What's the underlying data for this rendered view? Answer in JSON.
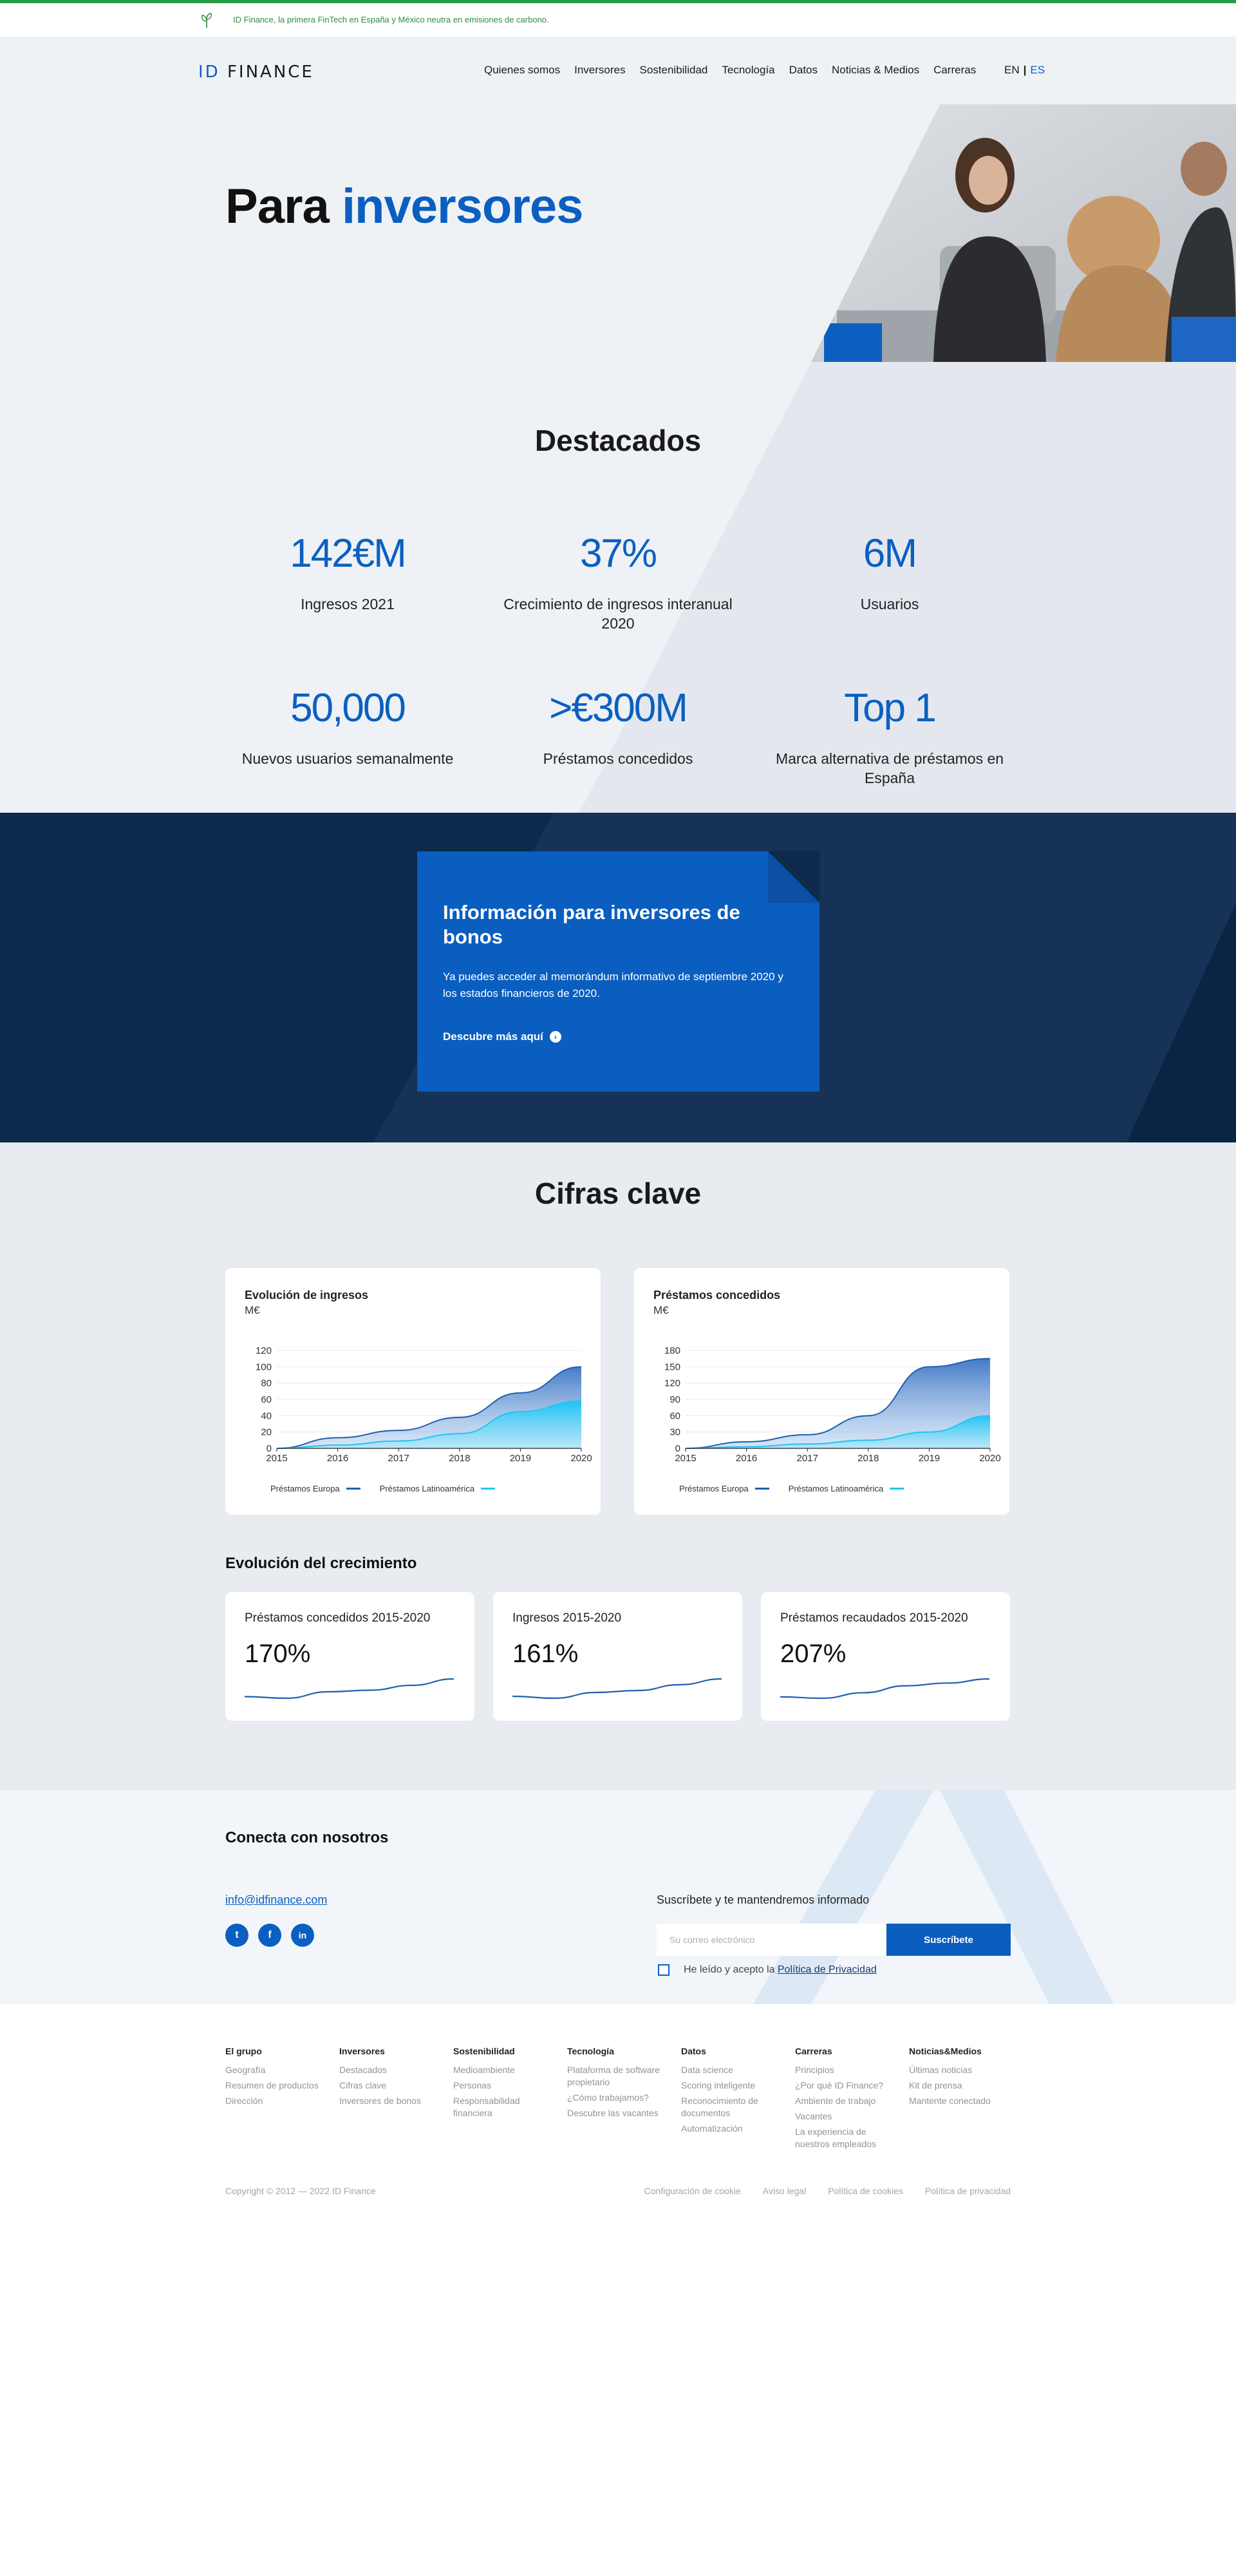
{
  "eco_banner": {
    "text": "ID Finance, la primera FinTech en España y México neutra en emisiones de carbono.",
    "icon": "leaf-icon"
  },
  "header": {
    "logo_id": "ID",
    "logo_name": "FINANCE",
    "nav": [
      "Quienes somos",
      "Inversores",
      "Sostenibilidad",
      "Tecnología",
      "Datos",
      "Noticias & Medios",
      "Carreras"
    ],
    "lang_en": "EN",
    "lang_sep": "|",
    "lang_es": "ES"
  },
  "hero": {
    "title_part1": "Para",
    "title_part2": "inversores"
  },
  "highlights": {
    "title": "Destacados",
    "stats": [
      {
        "value": "142€M",
        "label": "Ingresos 2021"
      },
      {
        "value": "37%",
        "label": "Crecimiento de ingresos interanual 2020"
      },
      {
        "value": "6M",
        "label": "Usuarios"
      },
      {
        "value": "50,000",
        "label": "Nuevos usuarios semanalmente"
      },
      {
        "value": ">€300M",
        "label": "Préstamos concedidos"
      },
      {
        "value": "Top 1",
        "label": "Marca alternativa de préstamos en España"
      }
    ]
  },
  "bonds": {
    "title": "Información para inversores de bonos",
    "text": "Ya puedes acceder al memorándum informativo de septiembre 2020 y los estados financieros de 2020.",
    "cta": "Descubre más aquí"
  },
  "key_figures": {
    "title": "Cifras clave",
    "growth_title": "Evolución del crecimiento",
    "growth_cards": [
      {
        "title": "Préstamos concedidos 2015-2020",
        "value": "170%"
      },
      {
        "title": "Ingresos 2015-2020",
        "value": "161%"
      },
      {
        "title": "Préstamos recaudados 2015-2020",
        "value": "207%"
      }
    ]
  },
  "chart_data": [
    {
      "type": "area",
      "title": "Evolución de ingresos",
      "ylabel": "M€",
      "x": [
        "2015",
        "2016",
        "2017",
        "2018",
        "2019",
        "2020"
      ],
      "ylim": [
        0,
        120
      ],
      "yticks": [
        0,
        20,
        40,
        60,
        80,
        100,
        120
      ],
      "series": [
        {
          "name": "Préstamos Europa",
          "color": "#1f5fb0",
          "values": [
            0,
            13,
            22,
            38,
            68,
            100
          ]
        },
        {
          "name": "Préstamos Latinoamérica",
          "color": "#22c4f0",
          "values": [
            0,
            4,
            9,
            18,
            45,
            58
          ]
        }
      ]
    },
    {
      "type": "area",
      "title": "Préstamos concedidos",
      "ylabel": "M€",
      "x": [
        "2015",
        "2016",
        "2017",
        "2018",
        "2019",
        "2020"
      ],
      "ylim": [
        0,
        180
      ],
      "yticks": [
        0,
        30,
        60,
        90,
        120,
        150,
        180
      ],
      "series": [
        {
          "name": "Préstamos Europa",
          "color": "#1f5fb0",
          "values": [
            0,
            12,
            25,
            60,
            150,
            165
          ]
        },
        {
          "name": "Préstamos Latinoamérica",
          "color": "#22c4f0",
          "values": [
            0,
            3,
            8,
            15,
            30,
            60
          ]
        }
      ]
    }
  ],
  "sparklines": [
    [
      5,
      4,
      8,
      9,
      12,
      16
    ],
    [
      6,
      5,
      8,
      9,
      12,
      15
    ],
    [
      3,
      2,
      6,
      11,
      13,
      16
    ]
  ],
  "connect": {
    "title": "Conecta con nosotros",
    "email": "info@idfinance.com",
    "social": [
      {
        "icon": "twitter-icon",
        "glyph": "t"
      },
      {
        "icon": "facebook-icon",
        "glyph": "f"
      },
      {
        "icon": "linkedin-icon",
        "glyph": "in"
      }
    ],
    "subscribe_label": "Suscríbete y te mantendremos informado",
    "email_placeholder": "Su correo electrónico",
    "subscribe_button": "Suscríbete",
    "consent_text": "He leído y acepto la",
    "consent_link": "Política de Privacidad"
  },
  "footer": {
    "columns": [
      {
        "heading": "El grupo",
        "items": [
          "Geografía",
          "Resumen de productos",
          "Dirección"
        ]
      },
      {
        "heading": "Inversores",
        "items": [
          "Destacados",
          "Cifras clave",
          "Inversores de bonos"
        ]
      },
      {
        "heading": "Sostenibilidad",
        "items": [
          "Medioambiente",
          "Personas",
          "Responsabilidad financiera"
        ]
      },
      {
        "heading": "Tecnología",
        "items": [
          "Plataforma de software propietario",
          "¿Cómo trabajamos?",
          "Descubre las vacantes"
        ]
      },
      {
        "heading": "Datos",
        "items": [
          "Data science",
          "Scoring inteligente",
          "Reconocimiento de documentos",
          "Automatización"
        ]
      },
      {
        "heading": "Carreras",
        "items": [
          "Principios",
          "¿Por qué ID Finance?",
          "Ambiente de trabajo",
          "Vacantes",
          "La experiencia de nuestros empleados"
        ]
      },
      {
        "heading": "Noticias&Medios",
        "items": [
          "Últimas noticias",
          "Kit de prensa",
          "Mantente conectado"
        ]
      }
    ],
    "copyright": "Copyright © 2012 — 2022 ID Finance",
    "links": [
      "Configuración de cookie",
      "Aviso legal",
      "Política de cookies",
      "Política de privacidad"
    ]
  }
}
